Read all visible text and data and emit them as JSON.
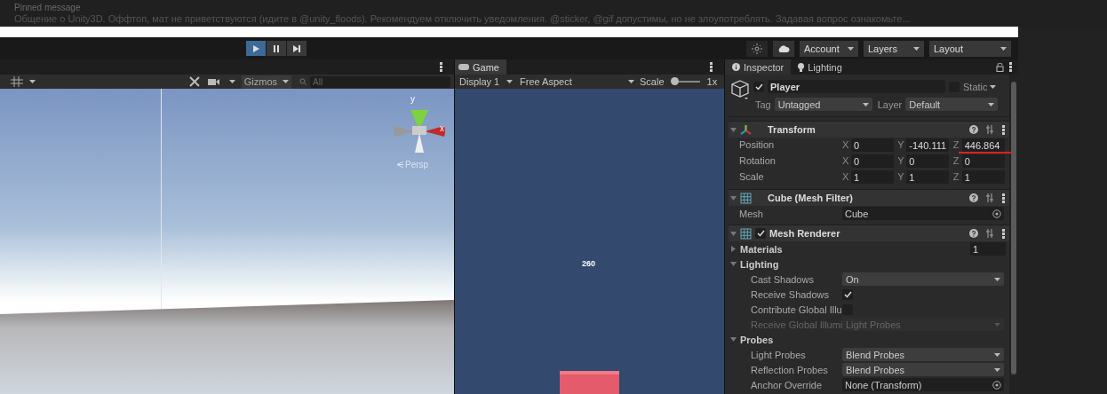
{
  "chat_header": {
    "title": "Pinned message",
    "text": "Общение о Unity3D. Оффтоп, мат не приветствуются (идите в @unity_floods). Рекомендуем отключить уведомления. @sticker, @gif допустимы, но не злоупотреблять. Задавая вопрос ознакомьте..."
  },
  "toolbar": {
    "play_buttons": [
      {
        "kind": "play",
        "selected": true
      },
      {
        "kind": "pause",
        "selected": false
      },
      {
        "kind": "step",
        "selected": false
      }
    ],
    "menus": [
      "Account",
      "Layers",
      "Layout"
    ]
  },
  "scene_view": {
    "gizmos": "Gizmos",
    "search_placeholder": "All",
    "axes": [
      "y",
      "x"
    ],
    "projection": "Persp"
  },
  "game_view": {
    "tab": "Game",
    "display": "Display 1",
    "aspect": "Free Aspect",
    "scale_label": "Scale",
    "scale_value": "1x",
    "scale": {
      "level": 0.1
    },
    "score": "260"
  },
  "inspector": {
    "tabs": [
      {
        "label": "Inspector",
        "selected": true
      },
      {
        "label": "Lighting",
        "selected": false
      }
    ],
    "object": {
      "active": true,
      "name": "Player",
      "static": false,
      "static_label": "Static",
      "tag_label": "Tag",
      "tag": "Untagged",
      "layer_label": "Layer",
      "layer": "Default"
    },
    "components": [
      {
        "kind": "transform",
        "title": "Transform",
        "rows": [
          {
            "label": "Position",
            "values": [
              {
                "axis": "X",
                "value": "0"
              },
              {
                "axis": "Y",
                "value": "-140.111"
              },
              {
                "axis": "Z",
                "value": "446.864"
              }
            ]
          },
          {
            "label": "Rotation",
            "values": [
              {
                "axis": "X",
                "value": "0"
              },
              {
                "axis": "Y",
                "value": "0"
              },
              {
                "axis": "Z",
                "value": "0"
              }
            ]
          },
          {
            "label": "Scale",
            "values": [
              {
                "axis": "X",
                "value": "1"
              },
              {
                "axis": "Y",
                "value": "1"
              },
              {
                "axis": "Z",
                "value": "1"
              }
            ]
          }
        ]
      },
      {
        "kind": "mesh_filter",
        "title": "Cube (Mesh Filter)",
        "fields": [
          {
            "kind": "object",
            "label": "Mesh",
            "value": "Cube"
          }
        ]
      },
      {
        "kind": "mesh_renderer",
        "title": "Mesh Renderer",
        "enabled": true,
        "fields": [
          {
            "kind": "foldout",
            "label": "Materials",
            "expanded": false,
            "value": "1"
          },
          {
            "kind": "foldout",
            "label": "Lighting",
            "expanded": true
          },
          {
            "kind": "dropdown",
            "label": "Cast Shadows",
            "value": "On",
            "disabled": false
          },
          {
            "kind": "checkbox",
            "label": "Receive Shadows",
            "checked": true
          },
          {
            "kind": "checkbox",
            "label": "Contribute Global Illu",
            "checked": false
          },
          {
            "kind": "dropdown",
            "label": "Receive Global Illumi",
            "value": "Light Probes",
            "disabled": true
          },
          {
            "kind": "foldout",
            "label": "Probes",
            "expanded": true
          },
          {
            "kind": "dropdown",
            "label": "Light Probes",
            "value": "Blend Probes",
            "disabled": false
          },
          {
            "kind": "dropdown",
            "label": "Reflection Probes",
            "value": "Blend Probes",
            "disabled": false
          },
          {
            "kind": "object",
            "label": "Anchor Override",
            "value": "None (Transform)"
          }
        ]
      }
    ]
  }
}
